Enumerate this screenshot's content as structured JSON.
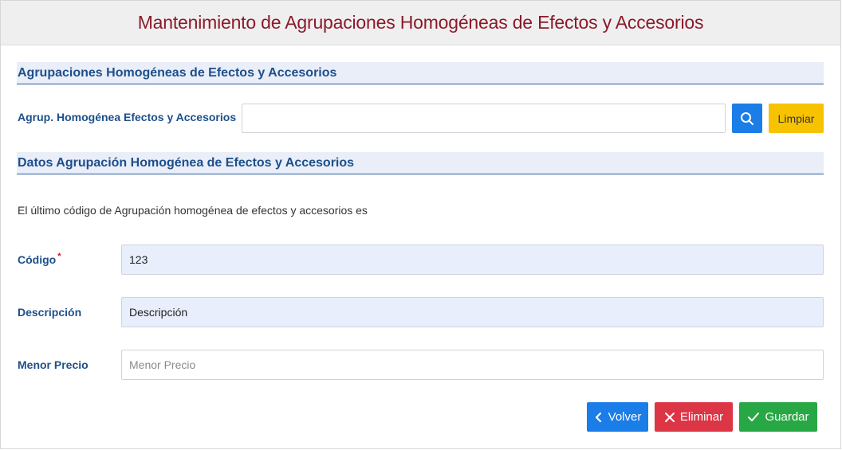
{
  "page": {
    "title": "Mantenimiento de Agrupaciones Homogéneas de Efectos y Accesorios"
  },
  "search_section": {
    "title": "Agrupaciones Homogéneas de Efectos y Accesorios",
    "field_label": "Agrup. Homogénea Efectos y Accesorios",
    "field_value": "",
    "search_icon": "search-icon",
    "clear_label": "Limpiar"
  },
  "data_section": {
    "title": "Datos Agrupación Homogénea de Efectos y Accesorios",
    "info_text": "El último código de Agrupación homogénea de efectos y accesorios es",
    "fields": {
      "codigo": {
        "label": "Código",
        "required_mark": "*",
        "value": "123"
      },
      "descripcion": {
        "label": "Descripción",
        "value": "Descripción"
      },
      "menor_precio": {
        "label": "Menor Precio",
        "value": "",
        "placeholder": "Menor Precio"
      }
    }
  },
  "actions": {
    "volver_label": "Volver",
    "volver_icon": "chevron-left-icon",
    "eliminar_label": "Eliminar",
    "eliminar_icon": "close-icon",
    "guardar_label": "Guardar",
    "guardar_icon": "check-icon"
  },
  "colors": {
    "title": "#8b1a2b",
    "section": "#1e4f8a",
    "primary": "#1a7de8",
    "warning": "#f7c200",
    "danger": "#dc3545",
    "success": "#28a745"
  }
}
